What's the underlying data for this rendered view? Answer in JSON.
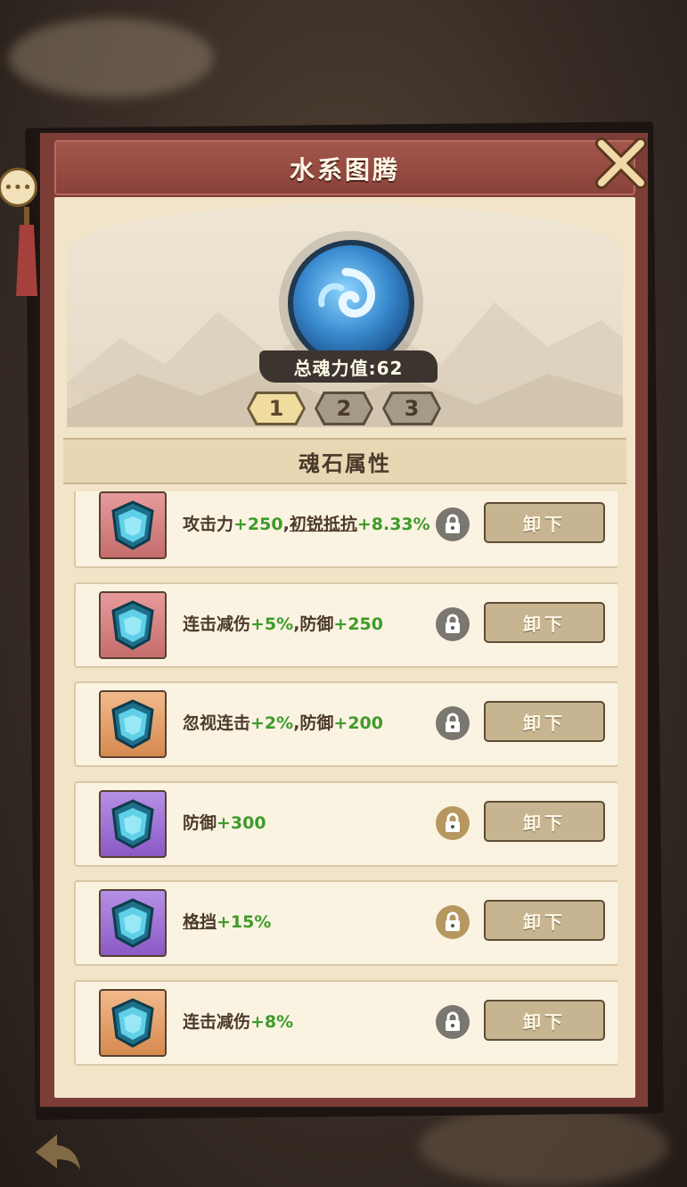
{
  "panel": {
    "title": "水系图腾",
    "total_power_label": "总魂力值:62",
    "section_title": "魂石属性"
  },
  "tabs": [
    {
      "label": "1",
      "active": true
    },
    {
      "label": "2",
      "active": false
    },
    {
      "label": "3",
      "active": false
    }
  ],
  "items": [
    {
      "gem_color": "red",
      "locked": true,
      "unload_label": "卸下",
      "parts": [
        {
          "t": "攻击力",
          "c": ""
        },
        {
          "t": "+250",
          "c": "g"
        },
        {
          "t": ",",
          "c": ""
        },
        {
          "t": "初锐抵抗",
          "c": "u"
        },
        {
          "t": "+8.33%",
          "c": "g"
        }
      ]
    },
    {
      "gem_color": "red",
      "locked": true,
      "unload_label": "卸下",
      "parts": [
        {
          "t": "连击减伤",
          "c": ""
        },
        {
          "t": "+5%",
          "c": "g"
        },
        {
          "t": ",防御",
          "c": ""
        },
        {
          "t": "+250",
          "c": "g"
        }
      ]
    },
    {
      "gem_color": "orange",
      "locked": true,
      "unload_label": "卸下",
      "parts": [
        {
          "t": "忽视连击",
          "c": ""
        },
        {
          "t": "+2%",
          "c": "g"
        },
        {
          "t": ",防御",
          "c": ""
        },
        {
          "t": "+200",
          "c": "g"
        }
      ]
    },
    {
      "gem_color": "purple",
      "locked": false,
      "unload_label": "卸下",
      "parts": [
        {
          "t": "防御",
          "c": ""
        },
        {
          "t": "+300",
          "c": "g"
        }
      ]
    },
    {
      "gem_color": "purple",
      "locked": false,
      "unload_label": "卸下",
      "parts": [
        {
          "t": "格挡",
          "c": "u"
        },
        {
          "t": "+15%",
          "c": "g"
        }
      ]
    },
    {
      "gem_color": "orange",
      "locked": true,
      "unload_label": "卸下",
      "parts": [
        {
          "t": "连击减伤",
          "c": ""
        },
        {
          "t": "+8%",
          "c": "g"
        }
      ]
    }
  ],
  "colors": {
    "panel_red": "#7d3d37",
    "parchment": "#f1e4c8",
    "stat_green": "#3e9b2a",
    "text_brown": "#4b3a2a"
  },
  "icons": {
    "close": "close-x-icon",
    "emblem": "water-totem-icon",
    "lock": "lock-icon",
    "chat": "chat-icon",
    "back": "back-arrow-icon"
  }
}
